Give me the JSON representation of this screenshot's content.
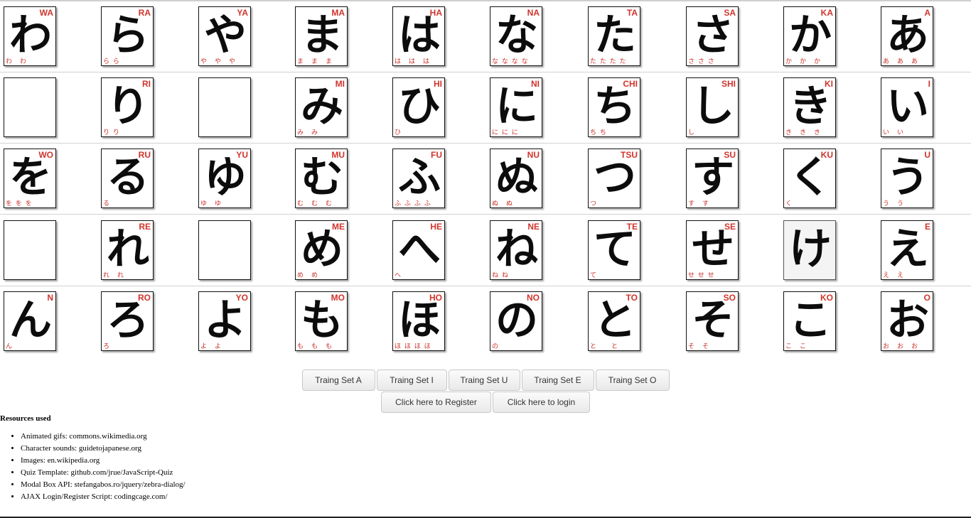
{
  "grid": {
    "rows": [
      [
        {
          "kana": "わ",
          "romaji": "WA",
          "strokes": "わ　わ"
        },
        {
          "kana": "ら",
          "romaji": "RA",
          "strokes": "ら ら"
        },
        {
          "kana": "や",
          "romaji": "YA",
          "strokes": "や　や　や"
        },
        {
          "kana": "ま",
          "romaji": "MA",
          "strokes": "ま　ま　ま"
        },
        {
          "kana": "は",
          "romaji": "HA",
          "strokes": "は　は　は"
        },
        {
          "kana": "な",
          "romaji": "NA",
          "strokes": "な な な な"
        },
        {
          "kana": "た",
          "romaji": "TA",
          "strokes": "た た た た"
        },
        {
          "kana": "さ",
          "romaji": "SA",
          "strokes": "さ さ さ"
        },
        {
          "kana": "か",
          "romaji": "KA",
          "strokes": "か　か　か"
        },
        {
          "kana": "あ",
          "romaji": "A",
          "strokes": "あ　あ　あ"
        }
      ],
      [
        {
          "empty": true
        },
        {
          "kana": "り",
          "romaji": "RI",
          "strokes": "り り"
        },
        {
          "empty": true
        },
        {
          "kana": "み",
          "romaji": "MI",
          "strokes": "み　み"
        },
        {
          "kana": "ひ",
          "romaji": "HI",
          "strokes": "ひ"
        },
        {
          "kana": "に",
          "romaji": "NI",
          "strokes": "に に に"
        },
        {
          "kana": "ち",
          "romaji": "CHI",
          "strokes": "ち ち"
        },
        {
          "kana": "し",
          "romaji": "SHI",
          "strokes": "し"
        },
        {
          "kana": "き",
          "romaji": "KI",
          "strokes": "き　き　き"
        },
        {
          "kana": "い",
          "romaji": "I",
          "strokes": "い　い"
        }
      ],
      [
        {
          "kana": "を",
          "romaji": "WO",
          "strokes": "を を を"
        },
        {
          "kana": "る",
          "romaji": "RU",
          "strokes": "る"
        },
        {
          "kana": "ゆ",
          "romaji": "YU",
          "strokes": "ゆ　ゆ"
        },
        {
          "kana": "む",
          "romaji": "MU",
          "strokes": "む　む　む"
        },
        {
          "kana": "ふ",
          "romaji": "FU",
          "strokes": "ふ ふ ふ ふ"
        },
        {
          "kana": "ぬ",
          "romaji": "NU",
          "strokes": "ぬ　ぬ"
        },
        {
          "kana": "つ",
          "romaji": "TSU",
          "strokes": "つ"
        },
        {
          "kana": "す",
          "romaji": "SU",
          "strokes": "す　す"
        },
        {
          "kana": "く",
          "romaji": "KU",
          "strokes": "く"
        },
        {
          "kana": "う",
          "romaji": "U",
          "strokes": "う　う"
        }
      ],
      [
        {
          "empty": true
        },
        {
          "kana": "れ",
          "romaji": "RE",
          "strokes": "れ　れ"
        },
        {
          "empty": true
        },
        {
          "kana": "め",
          "romaji": "ME",
          "strokes": "め　め"
        },
        {
          "kana": "へ",
          "romaji": "HE",
          "strokes": "へ"
        },
        {
          "kana": "ね",
          "romaji": "NE",
          "strokes": "ね ね"
        },
        {
          "kana": "て",
          "romaji": "TE",
          "strokes": "て"
        },
        {
          "kana": "せ",
          "romaji": "SE",
          "strokes": "せ せ せ"
        },
        {
          "kana": "け",
          "romaji": "",
          "strokes": "",
          "boxed": true
        },
        {
          "kana": "え",
          "romaji": "E",
          "strokes": "え　え"
        }
      ],
      [
        {
          "kana": "ん",
          "romaji": "N",
          "strokes": "ん"
        },
        {
          "kana": "ろ",
          "romaji": "RO",
          "strokes": "ろ"
        },
        {
          "kana": "よ",
          "romaji": "YO",
          "strokes": "よ　よ"
        },
        {
          "kana": "も",
          "romaji": "MO",
          "strokes": "も　も　も"
        },
        {
          "kana": "ほ",
          "romaji": "HO",
          "strokes": "ほ ほ ほ ほ"
        },
        {
          "kana": "の",
          "romaji": "NO",
          "strokes": "の"
        },
        {
          "kana": "と",
          "romaji": "TO",
          "strokes": "と　　と"
        },
        {
          "kana": "そ",
          "romaji": "SO",
          "strokes": "そ　そ"
        },
        {
          "kana": "こ",
          "romaji": "KO",
          "strokes": "こ　こ"
        },
        {
          "kana": "お",
          "romaji": "O",
          "strokes": "お　お　お"
        }
      ]
    ]
  },
  "training_sets": [
    "Traing Set A",
    "Traing Set I",
    "Traing Set U",
    "Traing Set E",
    "Traing Set O"
  ],
  "auth": {
    "register_label": "Click here to Register",
    "login_label": "Click here to login"
  },
  "resources": {
    "heading": "Resources used",
    "items": [
      "Animated gifs: commons.wikimedia.org",
      "Character sounds: guidetojapanese.org",
      "Images: en.wikipedia.org",
      "Quiz Template: github.com/jrue/JavaScript-Quiz",
      "Modal Box API: stefangabos.ro/jquery/zebra-dialog/",
      "AJAX Login/Register Script: codingcage.com/"
    ]
  },
  "colors": {
    "romaji": "#d0342c",
    "stroke_hint": "#c8322b",
    "glyph": "#0c0c0c"
  }
}
